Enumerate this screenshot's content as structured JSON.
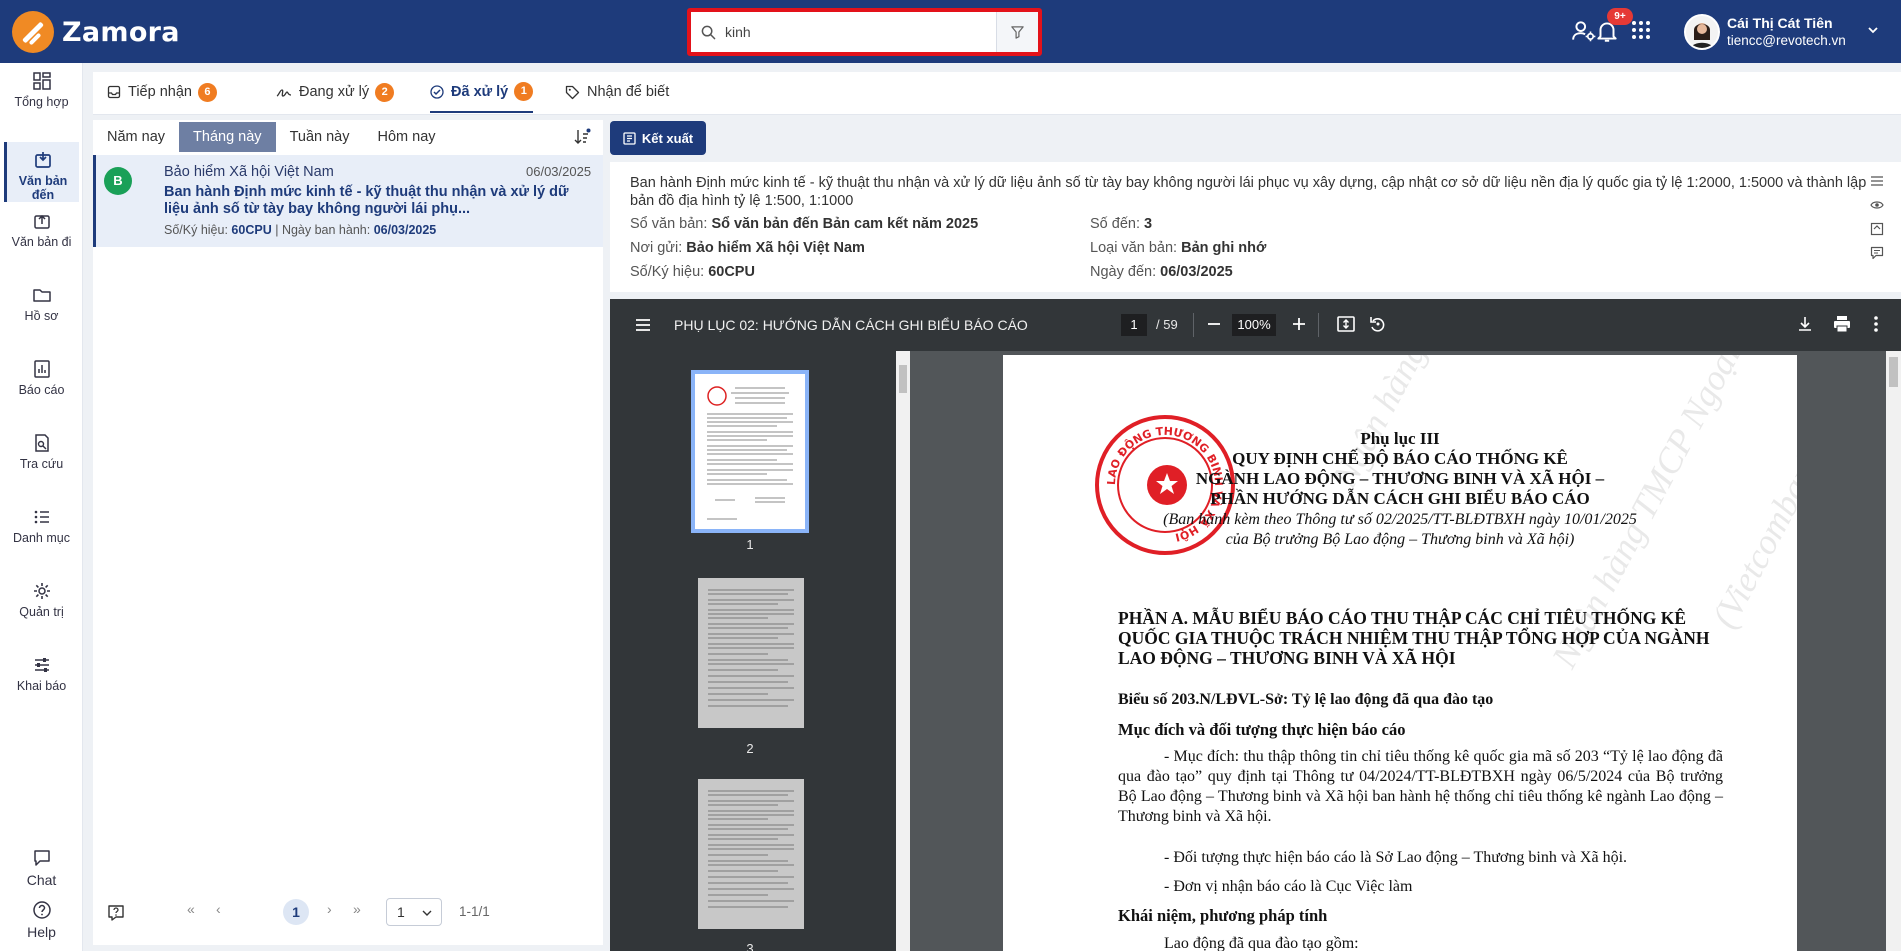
{
  "app": {
    "name": "Zamora"
  },
  "search": {
    "value": "kinh"
  },
  "header": {
    "notification_badge": "9+",
    "user_name": "Cái Thị Cát Tiên",
    "user_email": "tiencc@revotech.vn"
  },
  "nav": {
    "items": [
      {
        "label": "Tổng hợp",
        "icon": "dashboard-icon"
      },
      {
        "label": "Văn bản đến",
        "icon": "inbox-icon"
      },
      {
        "label": "Văn bản đi",
        "icon": "outbox-icon"
      },
      {
        "label": "Hồ sơ",
        "icon": "folder-icon"
      },
      {
        "label": "Báo cáo",
        "icon": "report-icon"
      },
      {
        "label": "Tra cứu",
        "icon": "search-doc-icon"
      },
      {
        "label": "Danh mục",
        "icon": "list-icon"
      },
      {
        "label": "Quản trị",
        "icon": "gear-icon"
      },
      {
        "label": "Khai báo",
        "icon": "sliders-icon"
      }
    ],
    "chat": "Chat",
    "help": "Help"
  },
  "tabs": [
    {
      "label": "Tiếp nhận",
      "count": "6"
    },
    {
      "label": "Đang xử lý",
      "count": "2"
    },
    {
      "label": "Đã xử lý",
      "count": "1"
    },
    {
      "label": "Nhận để biết"
    }
  ],
  "periods": [
    "Năm nay",
    "Tháng này",
    "Tuần này",
    "Hôm nay"
  ],
  "list": {
    "items": [
      {
        "avatar": "B",
        "sender": "Bảo hiểm Xã hội Việt Nam",
        "date": "06/03/2025",
        "title": "Ban hành Định mức kinh tế - kỹ thuật thu nhận và xử lý dữ liệu ảnh số từ tày bay không người lái phụ...",
        "code_label": "Số/Ký hiệu:",
        "code": "60CPU",
        "issued_label": "Ngày ban hành:",
        "issued": "06/03/2025"
      }
    ]
  },
  "pager": {
    "current": "1",
    "page_size": "1",
    "range": "1-1/1"
  },
  "export_label": "Kết xuất",
  "details": {
    "title": "Ban hành Định mức kinh tế - kỹ thuật thu nhận và xử lý dữ liệu ảnh số từ tày bay không người lái phục vụ xây dựng, cập nhật cơ sở dữ liệu nền địa lý quốc gia tỷ lệ 1:2000, 1:5000 và thành lập bản đồ địa hình tỷ lệ 1:500, 1:1000",
    "so_van_ban_label": "Sổ văn bản:",
    "so_van_ban": "Sổ văn bản đến Bản cam kết năm 2025",
    "so_den_label": "Số đến:",
    "so_den": "3",
    "noi_gui_label": "Nơi gửi:",
    "noi_gui": "Bảo hiểm Xã hội Việt Nam",
    "loai_label": "Loại văn bản:",
    "loai": "Bản ghi nhớ",
    "ky_hieu_label": "Số/Ký hiệu:",
    "ky_hieu": "60CPU",
    "ngay_den_label": "Ngày đến:",
    "ngay_den": "06/03/2025"
  },
  "pdf": {
    "title": "PHỤ LỤC 02: HƯỚNG DẪN CÁCH GHI BIỂU BÁO CÁO",
    "page": "1",
    "total": "/ 59",
    "zoom": "100%",
    "thumbs": [
      "1",
      "2",
      "3"
    ]
  },
  "document": {
    "heading": "Phụ lục III",
    "line1": "QUY ĐỊNH CHẾ ĐỘ BÁO CÁO THỐNG KÊ",
    "line2": "NGÀNH LAO ĐỘNG – THƯƠNG BINH VÀ XÃ HỘI –",
    "line3": "PHẦN HƯỚNG DẪN CÁCH GHI BIỂU BÁO CÁO",
    "line4": "(Ban hành kèm theo Thông tư số 02/2025/TT-BLĐTBXH ngày 10/01/2025",
    "line5": "của Bộ trưởng Bộ Lao động – Thương binh và Xã hội)",
    "section_a": "PHẦN A. MẪU  BIỂU BÁO CÁO THU THẬP CÁC CHỈ TIÊU THỐNG KÊ QUỐC GIA THUỘC TRÁCH NHIỆM THU THẬP TỔNG HỢP CỦA NGÀNH LAO ĐỘNG – THƯƠNG BINH VÀ XÃ HỘI",
    "bieu_so": "Biểu số 203.N/LĐVL-Sở: Tỷ lệ lao động đã qua đào tạo",
    "muc_dich": "Mục đích và đối tượng thực hiện báo cáo",
    "p1": "- Mục đích: thu thập thông tin chỉ tiêu thống kê quốc gia mã số 203 “Tỷ lệ lao động đã qua đào tạo” quy định tại Thông tư 04/2024/TT-BLĐTBXH ngày 06/5/2024 của Bộ trưởng Bộ Lao động – Thương binh và Xã hội ban hành hệ thống chỉ tiêu thống kê ngành Lao động – Thương binh và Xã hội.",
    "p2": "- Đối tượng thực hiện báo cáo là Sở Lao động – Thương binh và Xã hội.",
    "p3": "- Đơn vị nhận báo cáo là Cục Việc làm",
    "khai_niem": "Khái niệm, phương pháp tính",
    "p4": "Lao động đã qua đào tạo gồm:",
    "stamp_text": "LAO ĐỘNG THƯƠNG BINH VÀ XÃ HỘI"
  },
  "colors": {
    "primary": "#1e3b7b",
    "accent": "#f07c21",
    "highlight": "#e3121a"
  }
}
